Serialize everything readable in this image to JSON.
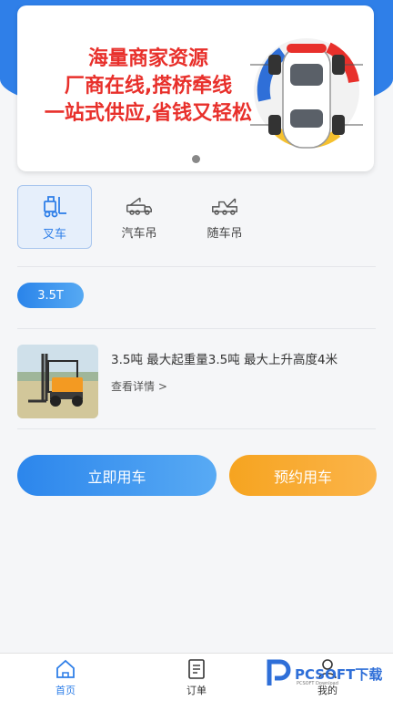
{
  "banner": {
    "lines": [
      "海量商家资源",
      "厂商在线,搭桥牵线",
      "一站式供应,省钱又轻松"
    ],
    "text_color": "#e8302b"
  },
  "categories": [
    {
      "label": "叉车",
      "icon": "forklift-icon",
      "active": true
    },
    {
      "label": "汽车吊",
      "icon": "truck-crane-icon",
      "active": false
    },
    {
      "label": "随车吊",
      "icon": "truck-mounted-crane-icon",
      "active": false
    }
  ],
  "spec": {
    "label": "3.5T"
  },
  "product": {
    "description": "3.5吨  最大起重量3.5吨  最大上升高度4米",
    "link": "查看详情 >"
  },
  "actions": {
    "use_now": "立即用车",
    "book": "预约用车"
  },
  "tabbar": [
    {
      "label": "首页",
      "icon": "home-icon",
      "active": true
    },
    {
      "label": "订单",
      "icon": "order-icon",
      "active": false
    },
    {
      "label": "我的",
      "icon": "profile-icon",
      "active": false
    }
  ],
  "watermark": {
    "text": "PCSOFT下载",
    "sub": "PCSOFT Download"
  },
  "colors": {
    "primary": "#2f7fe8",
    "accent": "#f6a420",
    "background": "#f5f6f8"
  }
}
